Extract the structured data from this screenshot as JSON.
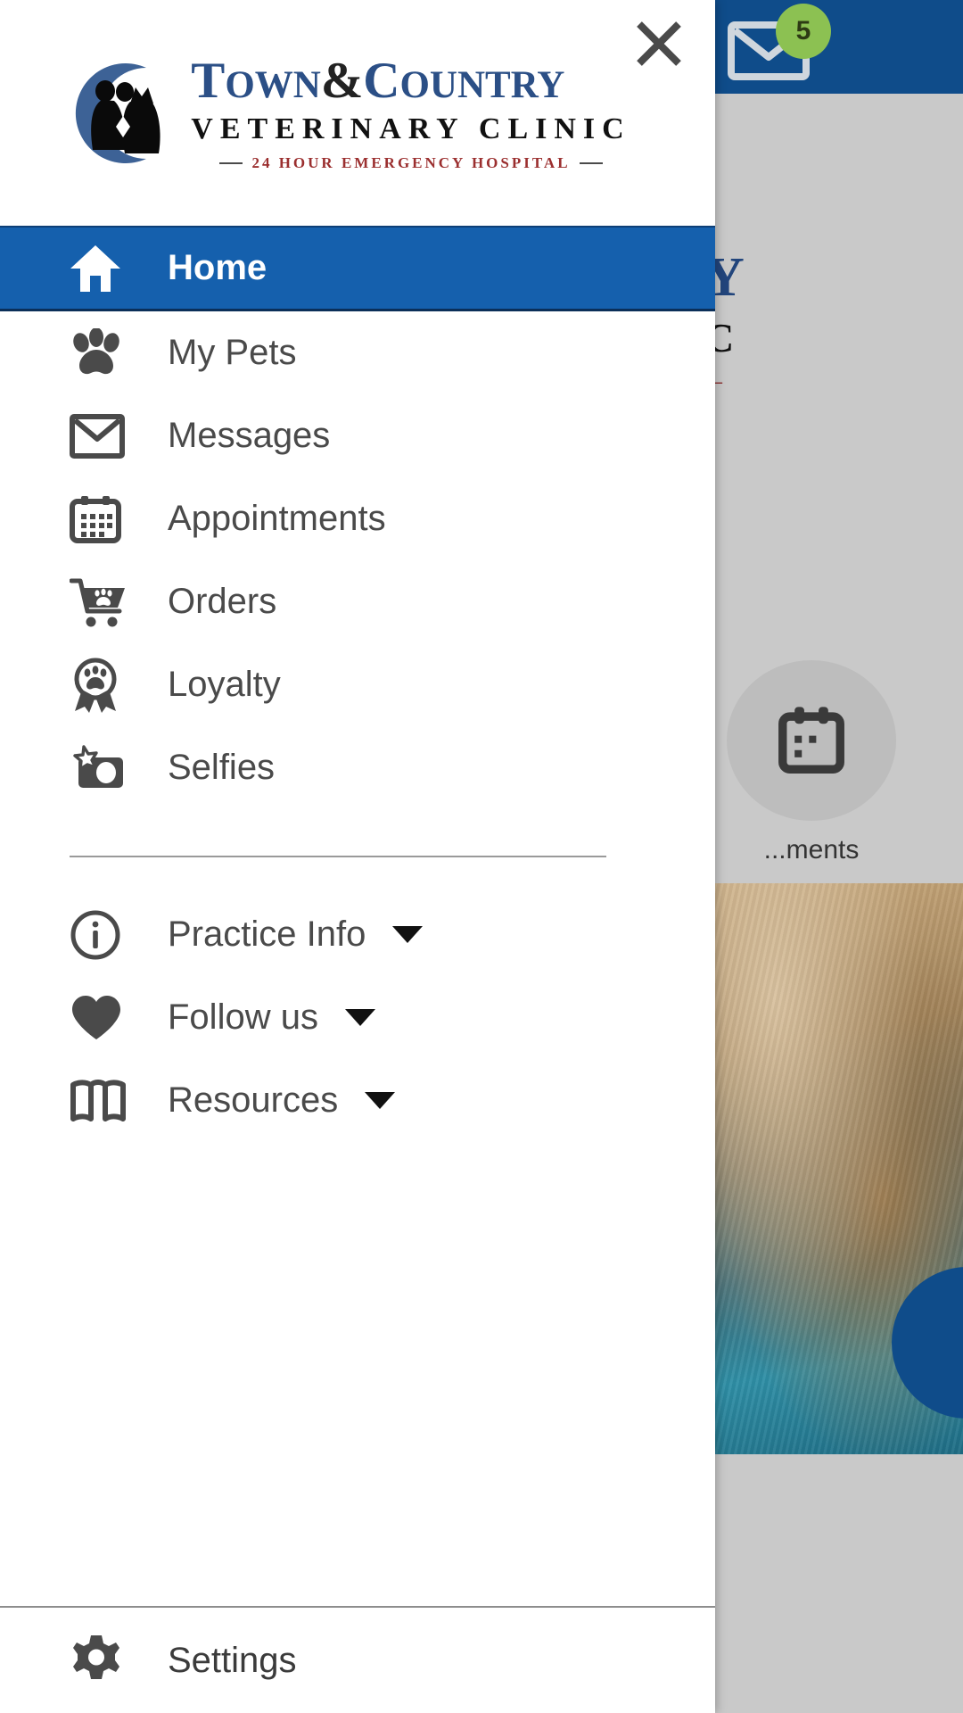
{
  "background": {
    "badge_count": "5",
    "mail_icon": "mail-icon",
    "logo_fragment": {
      "line1": "Y",
      "line2": "C",
      "line3": "—"
    },
    "tile": {
      "label": "...ments",
      "icon": "calendar-icon"
    },
    "photo_alt": "dog-swimming-photo",
    "fab": "floating-action-button"
  },
  "drawer": {
    "close_label": "✕",
    "logo": {
      "line1_a": "T",
      "line1_own": "OWN",
      "line1_amp": "&",
      "line1_c": "C",
      "line1_ountry": "OUNTRY",
      "line2": "VETERINARY CLINIC",
      "line3": "24 HOUR EMERGENCY HOSPITAL"
    },
    "primary_items": [
      {
        "label": "Home",
        "icon": "home-icon",
        "active": true
      },
      {
        "label": "My Pets",
        "icon": "paw-icon",
        "active": false
      },
      {
        "label": "Messages",
        "icon": "envelope-icon",
        "active": false
      },
      {
        "label": "Appointments",
        "icon": "calendar-icon",
        "active": false
      },
      {
        "label": "Orders",
        "icon": "cart-paw-icon",
        "active": false
      },
      {
        "label": "Loyalty",
        "icon": "award-paw-icon",
        "active": false
      },
      {
        "label": "Selfies",
        "icon": "camera-star-icon",
        "active": false
      }
    ],
    "secondary_items": [
      {
        "label": "Practice Info",
        "icon": "info-circle-icon",
        "caret": true
      },
      {
        "label": "Follow us",
        "icon": "heart-icon",
        "caret": true
      },
      {
        "label": "Resources",
        "icon": "open-book-icon",
        "caret": true
      }
    ],
    "footer_item": {
      "label": "Settings",
      "icon": "gear-icon"
    }
  },
  "colors": {
    "brand_blue": "#1560ad",
    "header_blue": "#0f4c8a",
    "logo_navy": "#2b4f86",
    "logo_red": "#9b2f2f",
    "badge_green": "#8cc152",
    "icon_gray": "#4a4a4a"
  }
}
